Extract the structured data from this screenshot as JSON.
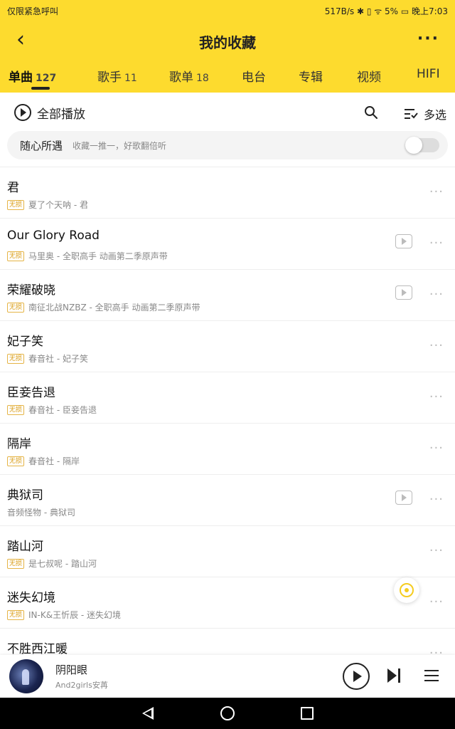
{
  "status_bar": {
    "left": "仅限紧急呼叫",
    "right": "517B/s ✱ ▯ ᯤ 5% ▭ 晚上7:03"
  },
  "header": {
    "title": "我的收藏"
  },
  "tabs": [
    {
      "label": "单曲",
      "count": "127"
    },
    {
      "label": "歌手",
      "count": "11"
    },
    {
      "label": "歌单",
      "count": "18"
    },
    {
      "label": "电台",
      "count": ""
    },
    {
      "label": "专辑",
      "count": ""
    },
    {
      "label": "视频",
      "count": ""
    },
    {
      "label": "HIFI",
      "count": ""
    }
  ],
  "toolbar": {
    "play_all_label": "全部播放",
    "multi_select_label": "多选"
  },
  "random_bar": {
    "title": "随心所遇",
    "subtitle": "收藏一推一，好歌翻倍听"
  },
  "badge_label": "无损",
  "songs": [
    {
      "name": "君",
      "sub": "夏了个天呐 - 君"
    },
    {
      "name": "Our Glory Road",
      "sub": "马里奥 - 全职高手 动画第二季原声带"
    },
    {
      "name": "荣耀破晓",
      "sub": "南征北战NZBZ - 全职高手 动画第二季原声带"
    },
    {
      "name": "妃子笑",
      "sub": "春音社 - 妃子笑"
    },
    {
      "name": "臣妾告退",
      "sub": "春音社 - 臣妾告退"
    },
    {
      "name": "隔岸",
      "sub": "春音社 - 隔岸"
    },
    {
      "name": "典狱司",
      "sub": "音频怪物 - 典狱司"
    },
    {
      "name": "踏山河",
      "sub": "是七叔呢 - 踏山河"
    },
    {
      "name": "迷失幻境",
      "sub": "IN-K&王忻辰 - 迷失幻境"
    },
    {
      "name": "不胜西江暖",
      "sub": ""
    }
  ],
  "now_playing": {
    "title": "阴阳眼",
    "artist": "And2girls安苒"
  },
  "colors": {
    "brand_yellow": "#fddb2e",
    "badge_gold": "#d99b12"
  },
  "icons": [
    "back-arrow-icon",
    "more-icon",
    "play-circle-icon",
    "search-icon",
    "multi-select-icon",
    "mv-icon",
    "more-dots-icon",
    "locate-icon",
    "play-icon",
    "next-icon",
    "playlist-icon"
  ]
}
